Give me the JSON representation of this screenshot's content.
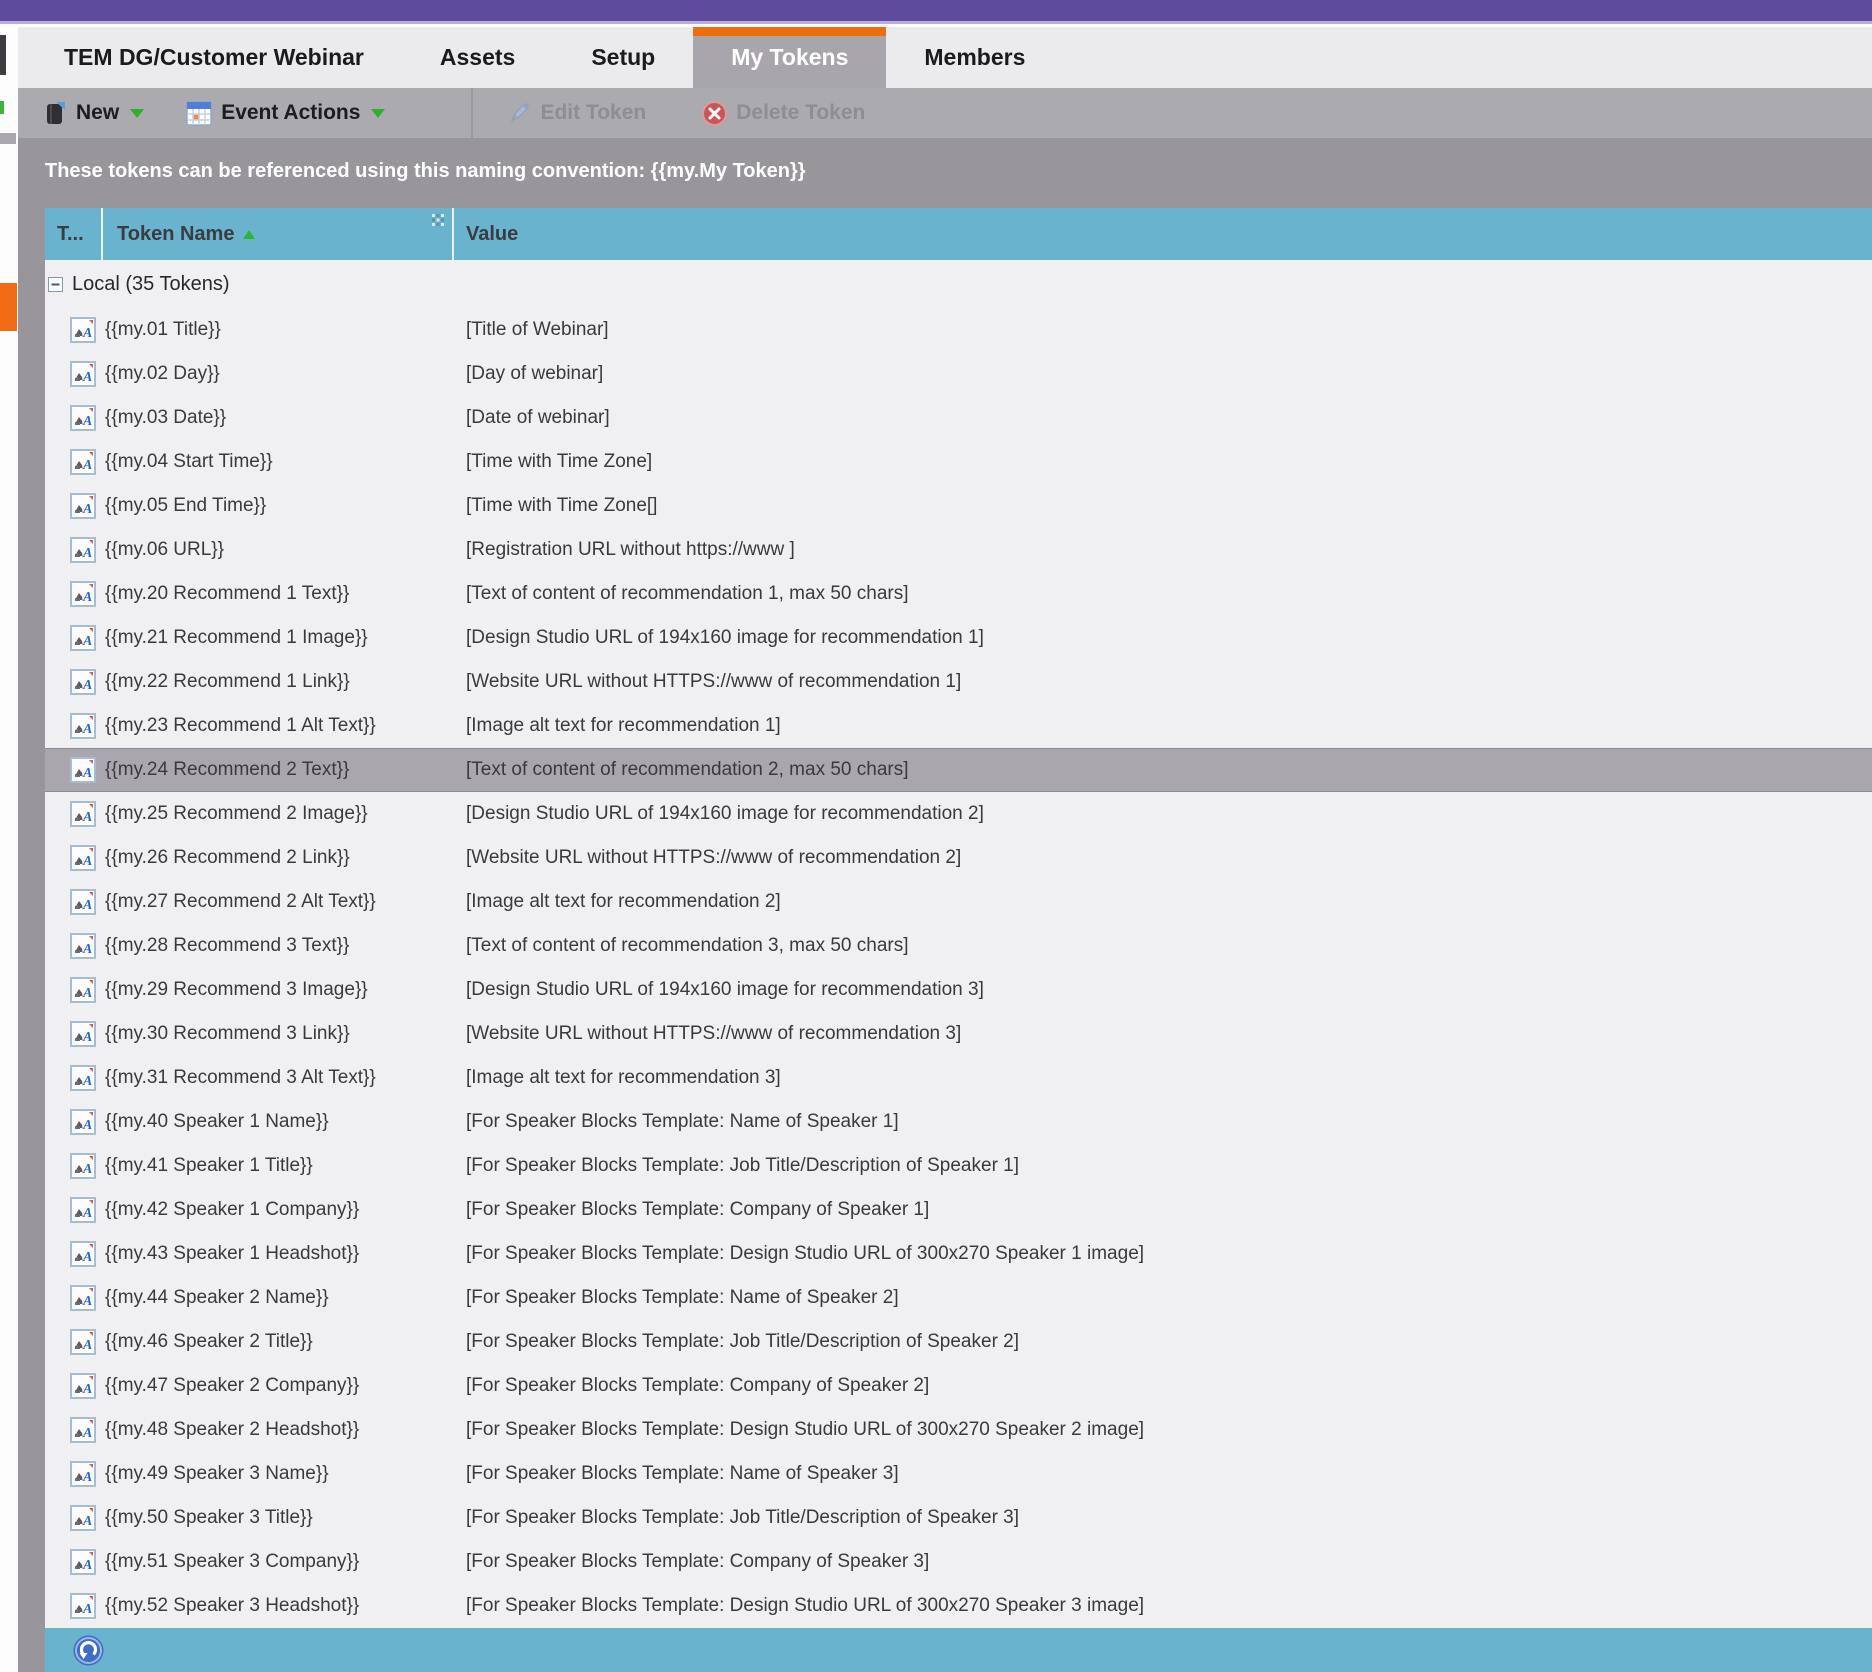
{
  "app": {
    "top_bar_color": "#5e4b9d",
    "accent_orange": "#ee6d0d",
    "header_teal": "#69b3cf",
    "selected_row_gray": "#a9a6ad"
  },
  "tabs": [
    {
      "label": "TEM DG/Customer Webinar",
      "active": false
    },
    {
      "label": "Assets",
      "active": false
    },
    {
      "label": "Setup",
      "active": false
    },
    {
      "label": "My Tokens",
      "active": true
    },
    {
      "label": "Members",
      "active": false
    }
  ],
  "toolbar": {
    "new_label": "New",
    "event_actions_label": "Event Actions",
    "edit_label": "Edit Token",
    "delete_label": "Delete Token"
  },
  "info_bar": {
    "text": "These tokens can be referenced using this naming convention: {{my.My Token}}"
  },
  "table": {
    "columns": [
      {
        "label": "T..."
      },
      {
        "label": "Token Name",
        "sorted": "asc"
      },
      {
        "label": "Value"
      }
    ],
    "group_label": "Local (35 Tokens)",
    "rows": [
      {
        "name": "{{my.01 Title}}",
        "value": "[Title of Webinar]",
        "selected": false
      },
      {
        "name": "{{my.02 Day}}",
        "value": "[Day of webinar]",
        "selected": false
      },
      {
        "name": "{{my.03 Date}}",
        "value": "[Date of webinar]",
        "selected": false
      },
      {
        "name": "{{my.04 Start Time}}",
        "value": "[Time with Time Zone]",
        "selected": false
      },
      {
        "name": "{{my.05 End Time}}",
        "value": "[Time with Time Zone[]",
        "selected": false
      },
      {
        "name": "{{my.06 URL}}",
        "value": "[Registration URL without https://www ]",
        "selected": false
      },
      {
        "name": "{{my.20 Recommend 1 Text}}",
        "value": "[Text of content of recommendation 1, max 50 chars]",
        "selected": false
      },
      {
        "name": "{{my.21 Recommend 1 Image}}",
        "value": "[Design Studio URL of 194x160 image for recommendation 1]",
        "selected": false
      },
      {
        "name": "{{my.22 Recommend 1 Link}}",
        "value": "[Website URL without HTTPS://www of recommendation 1]",
        "selected": false
      },
      {
        "name": "{{my.23 Recommend 1 Alt Text}}",
        "value": "[Image alt text for recommendation 1]",
        "selected": false
      },
      {
        "name": "{{my.24 Recommend 2 Text}}",
        "value": "[Text of content of recommendation 2, max 50 chars]",
        "selected": true
      },
      {
        "name": "{{my.25 Recommend 2 Image}}",
        "value": "[Design Studio URL of 194x160 image for recommendation 2]",
        "selected": false
      },
      {
        "name": "{{my.26 Recommend 2 Link}}",
        "value": "[Website URL without HTTPS://www of recommendation 2]",
        "selected": false
      },
      {
        "name": "{{my.27 Recommend 2 Alt Text}}",
        "value": "[Image alt text for recommendation 2]",
        "selected": false
      },
      {
        "name": "{{my.28 Recommend 3 Text}}",
        "value": "[Text of content of recommendation 3, max 50 chars]",
        "selected": false
      },
      {
        "name": "{{my.29 Recommend 3 Image}}",
        "value": "[Design Studio URL of 194x160 image for recommendation 3]",
        "selected": false
      },
      {
        "name": "{{my.30 Recommend 3 Link}}",
        "value": "[Website URL without HTTPS://www of recommendation 3]",
        "selected": false
      },
      {
        "name": "{{my.31 Recommend 3 Alt Text}}",
        "value": "[Image alt text for recommendation 3]",
        "selected": false
      },
      {
        "name": "{{my.40 Speaker 1 Name}}",
        "value": "[For Speaker Blocks Template: Name of Speaker 1]",
        "selected": false
      },
      {
        "name": "{{my.41 Speaker 1 Title}}",
        "value": "[For Speaker Blocks Template: Job Title/Description of Speaker 1]",
        "selected": false
      },
      {
        "name": "{{my.42 Speaker 1 Company}}",
        "value": "[For Speaker Blocks Template: Company of Speaker 1]",
        "selected": false
      },
      {
        "name": "{{my.43 Speaker 1 Headshot}}",
        "value": "[For Speaker Blocks Template: Design Studio URL of 300x270 Speaker 1 image]",
        "selected": false
      },
      {
        "name": "{{my.44 Speaker 2 Name}}",
        "value": "[For Speaker Blocks Template: Name of Speaker 2]",
        "selected": false
      },
      {
        "name": "{{my.46 Speaker 2 Title}}",
        "value": "[For Speaker Blocks Template: Job Title/Description of Speaker 2]",
        "selected": false
      },
      {
        "name": "{{my.47 Speaker 2 Company}}",
        "value": "[For Speaker Blocks Template: Company of Speaker 2]",
        "selected": false
      },
      {
        "name": "{{my.48 Speaker 2 Headshot}}",
        "value": "[For Speaker Blocks Template: Design Studio URL of 300x270 Speaker 2 image]",
        "selected": false
      },
      {
        "name": "{{my.49 Speaker 3 Name}}",
        "value": "[For Speaker Blocks Template: Name of Speaker 3]",
        "selected": false
      },
      {
        "name": "{{my.50 Speaker 3 Title}}",
        "value": "[For Speaker Blocks Template: Job Title/Description of Speaker 3]",
        "selected": false
      },
      {
        "name": "{{my.51 Speaker 3 Company}}",
        "value": "[For Speaker Blocks Template: Company of Speaker 3]",
        "selected": false
      },
      {
        "name": "{{my.52 Speaker 3 Headshot}}",
        "value": "[For Speaker Blocks Template: Design Studio URL of 300x270 Speaker 3 image]",
        "selected": false
      }
    ]
  }
}
